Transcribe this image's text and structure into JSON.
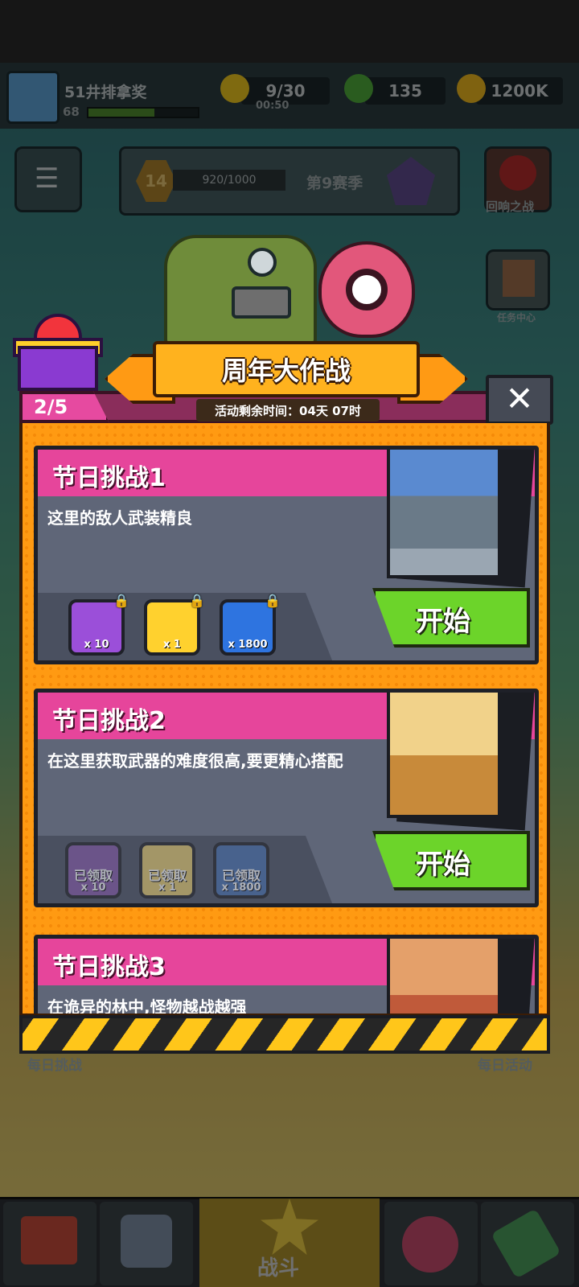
{
  "player": {
    "name": "51井排拿奖",
    "level": "68"
  },
  "resources": {
    "energy": {
      "value": "9/30",
      "timer": "00:50"
    },
    "gems": {
      "value": "135"
    },
    "coins": {
      "value": "1200K"
    }
  },
  "season": {
    "level": "14",
    "xp": "920/1000",
    "name": "第9赛季"
  },
  "side": {
    "right_top": "回响之战",
    "right_mid": "任务中心",
    "left_bottom": "每日挑战",
    "right_bottom": "每日活动"
  },
  "nav": {
    "battle": "战斗"
  },
  "event": {
    "title": "周年大作战",
    "timer": "活动剩余时间：04天 07时",
    "progress": "2/5",
    "close": "✕"
  },
  "challenges": [
    {
      "title": "节日挑战1",
      "desc": "这里的敌人武装精良",
      "button": "开始",
      "rewards": [
        {
          "icon": "medkit-icon",
          "qty": "x 10",
          "locked": true,
          "color": "#9b4fd9"
        },
        {
          "icon": "key-icon",
          "qty": "x 1",
          "locked": true,
          "color": "#ffd12e"
        },
        {
          "icon": "flame-icon",
          "qty": "x 1800",
          "locked": true,
          "color": "#2e74e0"
        }
      ]
    },
    {
      "title": "节日挑战2",
      "desc": "在这里获取武器的难度很高,要更精心搭配",
      "button": "开始",
      "rewards": [
        {
          "icon": "medkit-icon",
          "qty": "x 10",
          "claimed": "已领取",
          "color": "#9b4fd9"
        },
        {
          "icon": "key-icon",
          "qty": "x 1",
          "claimed": "已领取",
          "color": "#ffd12e"
        },
        {
          "icon": "flame-icon",
          "qty": "x 1800",
          "claimed": "已领取",
          "color": "#2e74e0"
        }
      ]
    },
    {
      "title": "节日挑战3",
      "desc": "在诡异的林中,怪物越战越强"
    }
  ]
}
